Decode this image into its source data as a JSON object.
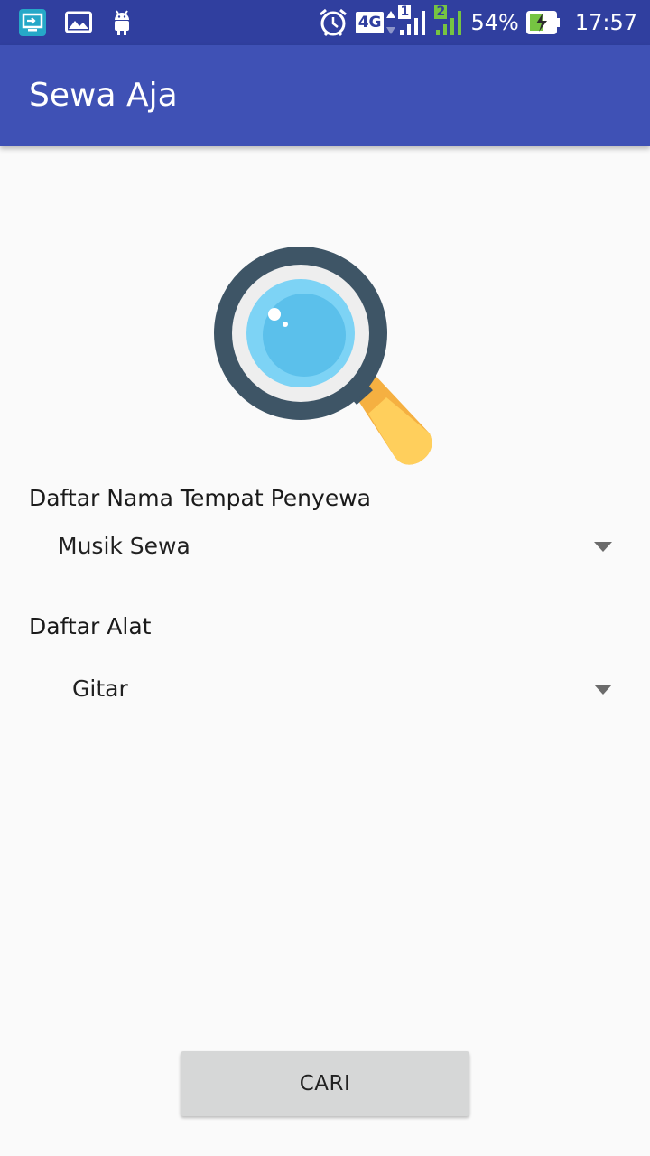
{
  "status_bar": {
    "network_type": "4G",
    "sim1_label": "1",
    "sim2_label": "2",
    "battery_percent": "54%",
    "time": "17:57",
    "icons": [
      "screen-cast-icon",
      "gallery-icon",
      "android-icon",
      "alarm-icon",
      "signal-icon",
      "battery-charging-icon"
    ],
    "colors": {
      "background": "#303f9f",
      "sim2_accent": "#76c442"
    }
  },
  "app_bar": {
    "title": "Sewa Aja",
    "color": "#3f51b5"
  },
  "form": {
    "place_label": "Daftar Nama Tempat Penyewa",
    "place_selected": "Musik Sewa",
    "tool_label": "Daftar Alat",
    "tool_selected": "Gitar"
  },
  "search_button": {
    "label": "CARI"
  },
  "illustration": {
    "icon": "magnifier-icon",
    "colors": {
      "ring": "#3e5566",
      "lens": "#5bc0eb",
      "handle": "#ffcf5c"
    }
  }
}
